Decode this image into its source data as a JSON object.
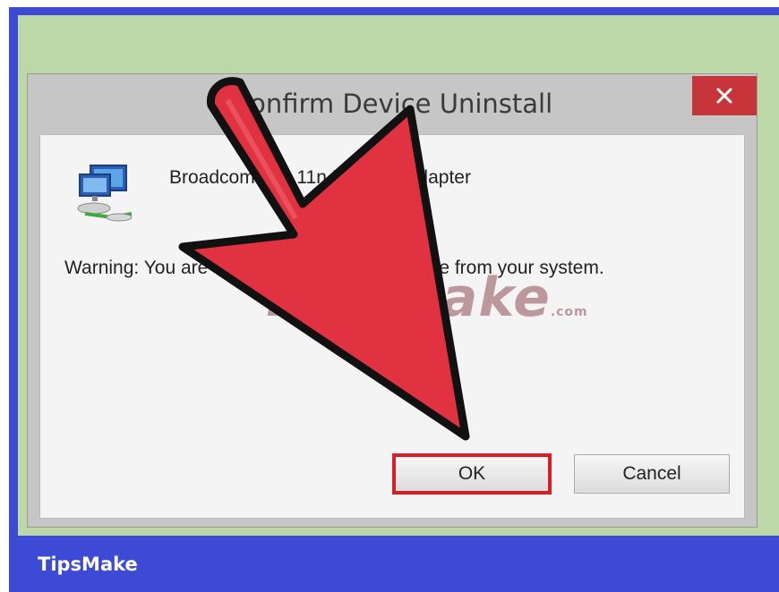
{
  "dialog": {
    "title": "Confirm Device Uninstall",
    "close_icon": "close-icon",
    "device_icon": "network-adapter-icon",
    "device_name": "Broadcom 802.11n Network Adapter",
    "warning": "Warning: You are about to uninstall this device from your system.",
    "ok_label": "OK",
    "cancel_label": "Cancel",
    "ok_highlight_color": "#d81d26"
  },
  "overlay": {
    "arrow_icon": "pointer-arrow-icon",
    "arrow_color": "#e03240",
    "watermark": "TipsMake",
    "watermark_suffix": ".com"
  },
  "footer": {
    "brand": "TipsMake",
    "background": "#3d4ad6"
  },
  "colors": {
    "desktop": "#bcd8a6",
    "close_button": "#c7353a"
  }
}
